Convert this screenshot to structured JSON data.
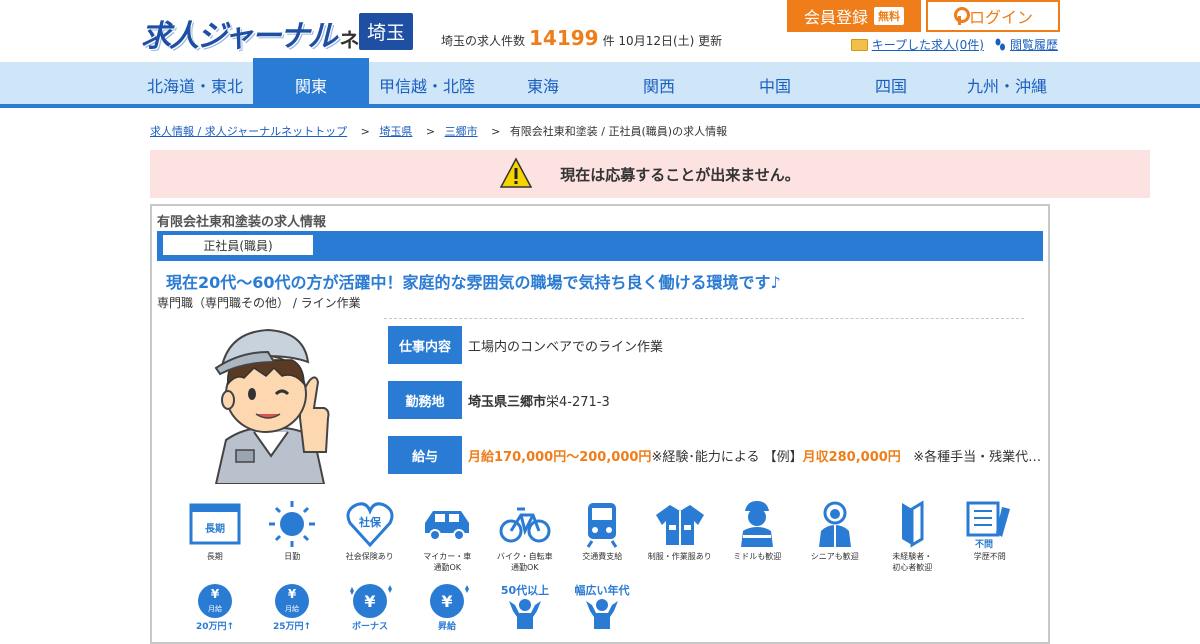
{
  "header": {
    "logo_main": "求人ジャーナル",
    "logo_sub": "ネット",
    "pref": "埼玉",
    "count_prefix": "埼玉の求人件数",
    "count": "14199",
    "count_suffix": "件 10月12日(土) 更新",
    "register_label": "会員登録",
    "free_label": "無料",
    "login_label": "ログイン",
    "kept_label": "キープした求人(0件)",
    "history_label": "閲覧履歴"
  },
  "nav": {
    "items": [
      {
        "label": "北海道・東北"
      },
      {
        "label": "関東"
      },
      {
        "label": "甲信越・北陸"
      },
      {
        "label": "東海"
      },
      {
        "label": "関西"
      },
      {
        "label": "中国"
      },
      {
        "label": "四国"
      },
      {
        "label": "九州・沖縄"
      }
    ]
  },
  "breadcrumb": {
    "items": [
      {
        "label": "求人情報 / 求人ジャーナルネットトップ"
      },
      {
        "label": "埼玉県"
      },
      {
        "label": "三郷市"
      }
    ],
    "current": "有限会社東和塗装 / 正社員(職員)の求人情報",
    "sep": ">"
  },
  "alert": {
    "text": "現在は応募することが出来ません。"
  },
  "job": {
    "title": "有限会社東和塗装の求人情報",
    "emp_type": "正社員(職員)",
    "catch": "現在20代～60代の方が活躍中！家庭的な雰囲気の職場で気持ち良く働ける環境です♪",
    "category": "専門職（専門職その他） / ライン作業",
    "rows": {
      "work_label": "仕事内容",
      "work_value": "工場内のコンベアでのライン作業",
      "place_label": "勤務地",
      "place_city": "埼玉県三郷市",
      "place_rest": "栄4-271-3",
      "pay_label": "給与",
      "pay_main": "月給170,000円～200,000円",
      "pay_note": "※経験･能力による 【例】",
      "pay_example": "月収280,000円",
      "pay_extra": "※各種手当・残業代…"
    }
  },
  "features": {
    "row1": [
      {
        "label": "長期",
        "icon": "calendar-long-icon"
      },
      {
        "label": "日勤",
        "icon": "sun-icon"
      },
      {
        "label": "社会保険あり",
        "icon": "heart-insurance-icon"
      },
      {
        "label": "マイカー・車通勤OK",
        "icon": "car-icon"
      },
      {
        "label": "バイク・自転車通勤OK",
        "icon": "bicycle-icon"
      },
      {
        "label": "交通費支給",
        "icon": "train-icon"
      },
      {
        "label": "制服・作業服あり",
        "icon": "uniform-icon"
      },
      {
        "label": "ミドルも歓迎",
        "icon": "worker-icon"
      },
      {
        "label": "シニアも歓迎",
        "icon": "senior-icon"
      },
      {
        "label": "未経験者・初心者歓迎",
        "icon": "beginner-icon"
      },
      {
        "label": "学歴不問",
        "icon": "education-icon"
      }
    ],
    "row2": [
      {
        "label": "月給20万円↑",
        "icon": "yen-20-icon"
      },
      {
        "label": "月給25万円↑",
        "icon": "yen-25-icon"
      },
      {
        "label": "ボーナス",
        "icon": "bonus-icon"
      },
      {
        "label": "昇給",
        "icon": "raise-icon"
      },
      {
        "label": "50代以上",
        "icon": "age-50-icon"
      },
      {
        "label": "幅広い年代",
        "icon": "wide-age-icon"
      }
    ],
    "calendar_text": "長期",
    "insurance_text": "社保",
    "education_text": "不問",
    "yen_sub1": "月給",
    "yen_amount1": "20万円↑",
    "yen_sub2": "月給",
    "yen_amount2": "25万円↑",
    "bonus_text": "ボーナス",
    "raise_text": "昇給",
    "age50_text": "50代以上",
    "wide_text": "幅広い年代",
    "row1_labels_multiline": [
      "マイカー・車",
      "通勤OK",
      "バイク・自転車",
      "通勤OK",
      "未経験者・",
      "初心者歓迎"
    ]
  },
  "colors": {
    "brand_blue": "#2a7bd3",
    "accent_orange": "#ee7d1a",
    "alert_bg": "#fde2e2",
    "nav_bg": "#cfe5f8"
  }
}
